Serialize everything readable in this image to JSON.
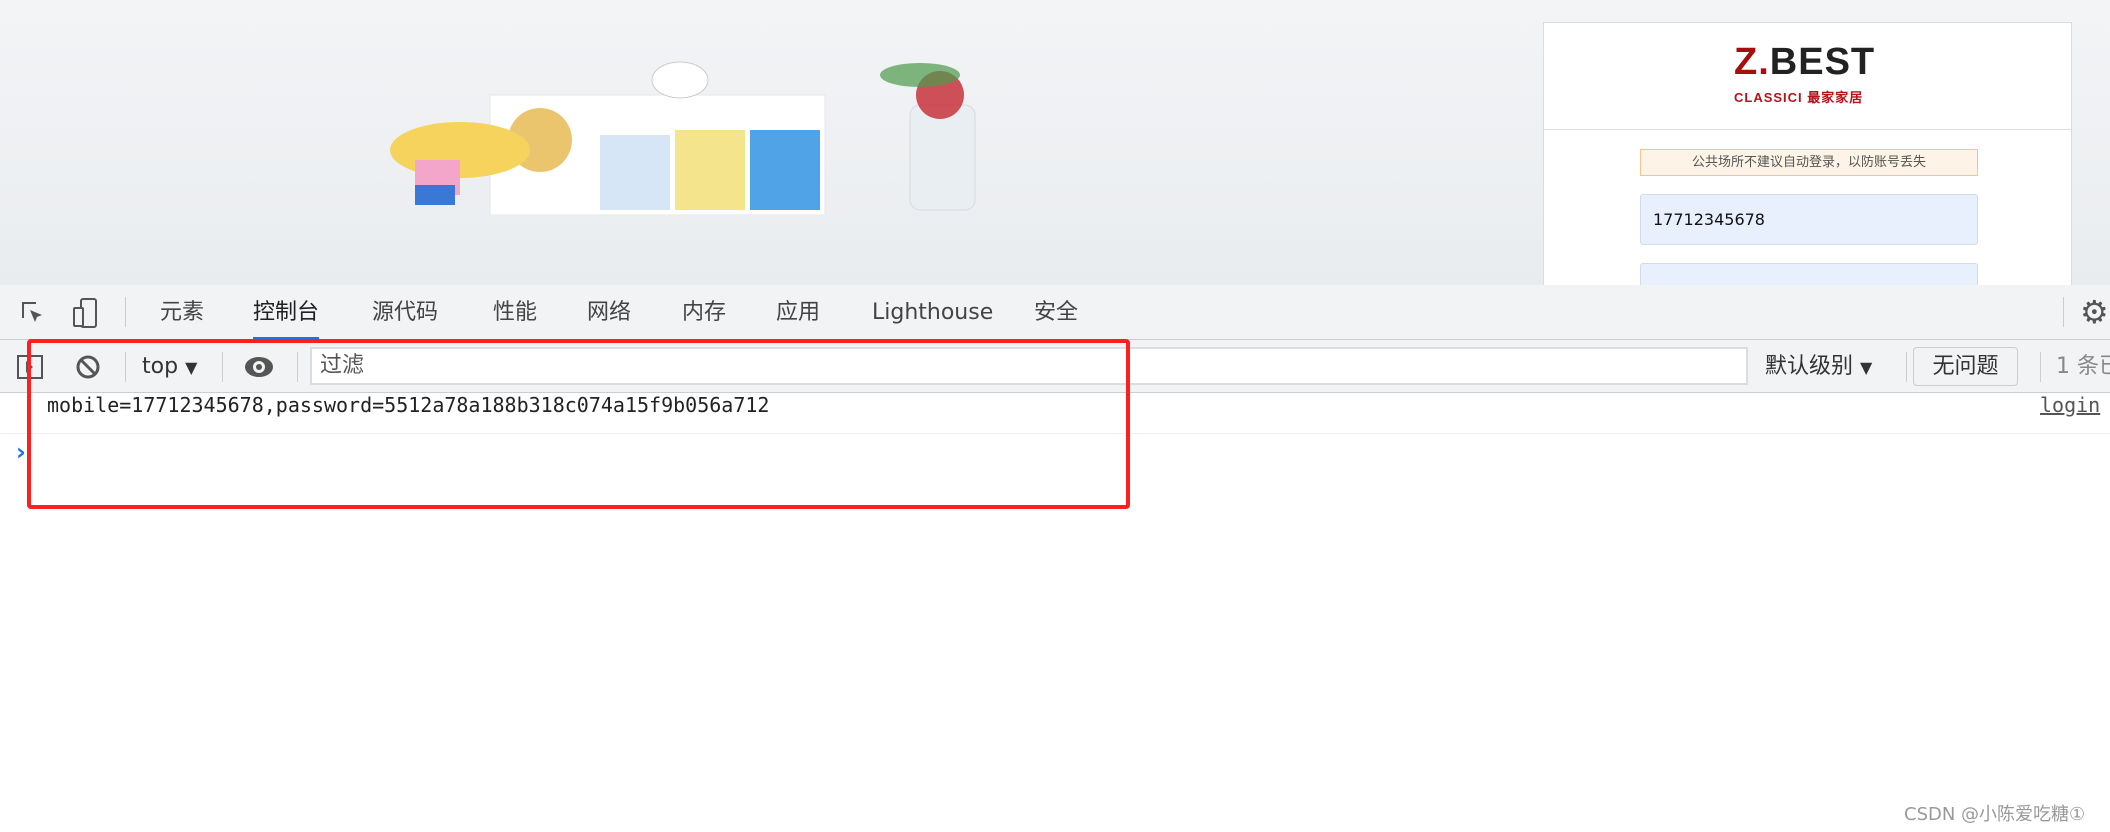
{
  "page": {
    "logo": {
      "brand": "Z.BEST",
      "sub": "CLASSICI 最家家居",
      "accent": "#a80d0d"
    },
    "notice": "公共场所不建议自动登录，以防账号丢失",
    "mobile_value": "17712345678",
    "password_value": ""
  },
  "devtools": {
    "tabs": [
      {
        "label": "元素"
      },
      {
        "label": "控制台",
        "active": true
      },
      {
        "label": "源代码"
      },
      {
        "label": "性能"
      },
      {
        "label": "网络"
      },
      {
        "label": "内存"
      },
      {
        "label": "应用"
      },
      {
        "label": "Lighthouse"
      },
      {
        "label": "安全"
      }
    ],
    "toolbar": {
      "context": "top",
      "filter_placeholder": "过滤",
      "level": "默认级别",
      "issues": "无问题",
      "hidden_count": "1 条已"
    },
    "log": {
      "message": "mobile=17712345678,password=5512a78a188b318c074a15f9b056a712",
      "source": "login"
    },
    "prompt": "›"
  },
  "highlight_color": "#ff1f1f",
  "watermark": "CSDN @小陈爱吃糖①"
}
